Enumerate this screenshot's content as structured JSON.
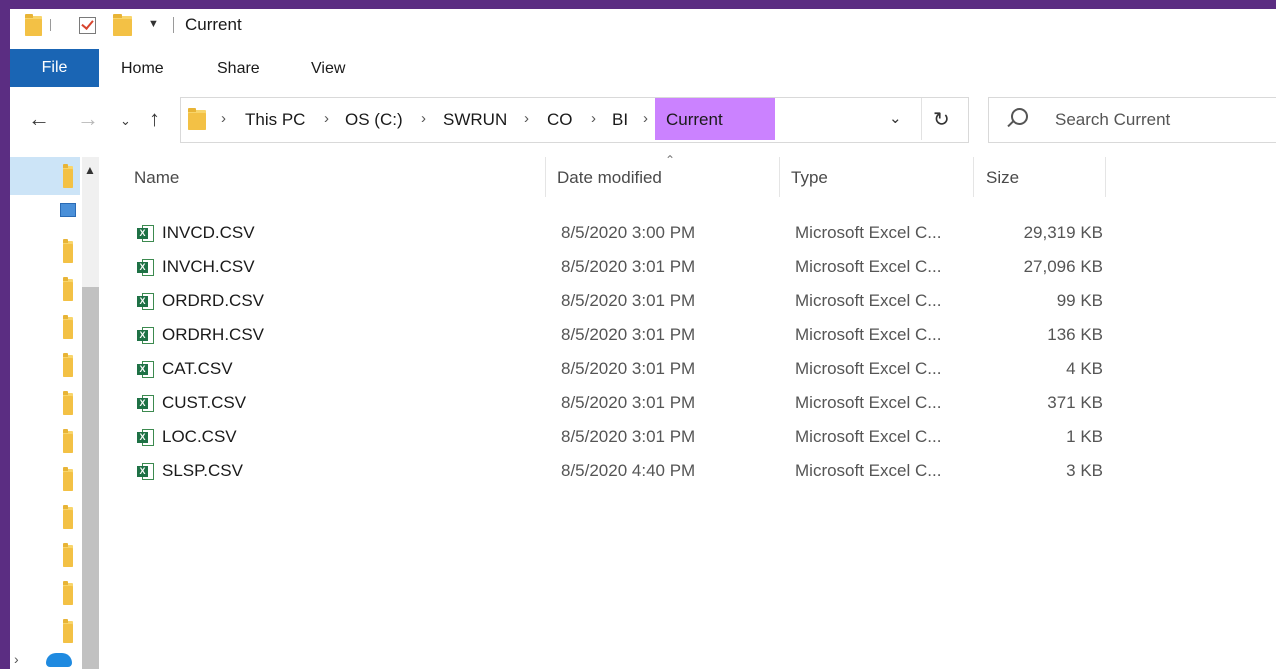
{
  "window": {
    "title": "Current"
  },
  "ribbon": {
    "file_label": "File",
    "tabs": [
      "Home",
      "Share",
      "View"
    ]
  },
  "address": {
    "crumbs": [
      "This PC",
      "OS (C:)",
      "SWRUN",
      "CO",
      "BI",
      "Current"
    ],
    "highlight_color": "#cb82ff"
  },
  "search": {
    "placeholder": "Search Current"
  },
  "columns": {
    "name": "Name",
    "date": "Date modified",
    "type": "Type",
    "size": "Size"
  },
  "files": [
    {
      "name": "INVCD.CSV",
      "date": "8/5/2020 3:00 PM",
      "type": "Microsoft Excel C...",
      "size": "29,319 KB"
    },
    {
      "name": "INVCH.CSV",
      "date": "8/5/2020 3:01 PM",
      "type": "Microsoft Excel C...",
      "size": "27,096 KB"
    },
    {
      "name": "ORDRD.CSV",
      "date": "8/5/2020 3:01 PM",
      "type": "Microsoft Excel C...",
      "size": "99 KB"
    },
    {
      "name": "ORDRH.CSV",
      "date": "8/5/2020 3:01 PM",
      "type": "Microsoft Excel C...",
      "size": "136 KB"
    },
    {
      "name": "CAT.CSV",
      "date": "8/5/2020 3:01 PM",
      "type": "Microsoft Excel C...",
      "size": "4 KB"
    },
    {
      "name": "CUST.CSV",
      "date": "8/5/2020 3:01 PM",
      "type": "Microsoft Excel C...",
      "size": "371 KB"
    },
    {
      "name": "LOC.CSV",
      "date": "8/5/2020 3:01 PM",
      "type": "Microsoft Excel C...",
      "size": "1 KB"
    },
    {
      "name": "SLSP.CSV",
      "date": "8/5/2020 4:40 PM",
      "type": "Microsoft Excel C...",
      "size": "3 KB"
    }
  ],
  "icons": {
    "back": "arrow-left-icon",
    "forward": "arrow-right-icon",
    "recent": "chevron-down-icon",
    "up": "arrow-up-icon",
    "refresh": "refresh-icon",
    "search": "search-icon",
    "file": "excel-csv-icon"
  },
  "colors": {
    "file_tab": "#1a65b4",
    "border": "#5b2d82",
    "nav_selected": "#cce4f7"
  }
}
